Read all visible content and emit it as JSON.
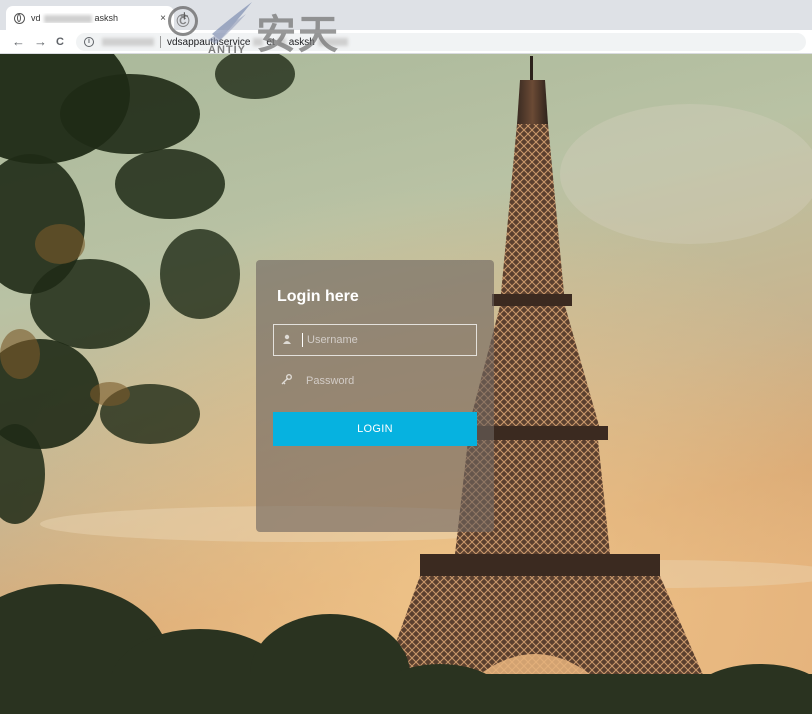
{
  "browser": {
    "tab_title_prefix": "vd",
    "tab_title_suffix": "asksh",
    "tab_close": "×",
    "new_tab": "+",
    "back": "←",
    "forward": "→",
    "reload": "C",
    "info": "i",
    "url_visible": "vdsappauthservice",
    "url_tail": "et",
    "url_tail2": "asksh"
  },
  "watermark": {
    "symbol": "©",
    "name": "安天",
    "sub": "ANTIY"
  },
  "login": {
    "title": "Login here",
    "username_placeholder": "Username",
    "password_placeholder": "Password",
    "button_label": "LOGIN"
  },
  "colors": {
    "button": "#06b2e0",
    "card": "rgba(110,100,95,0.62)"
  }
}
